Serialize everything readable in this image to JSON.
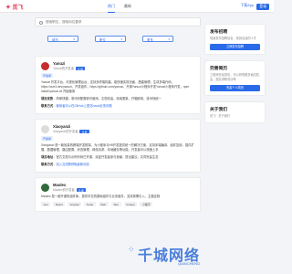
{
  "header": {
    "logo": "觅飞",
    "logo_icon": "feather-icon",
    "tabs": [
      {
        "label": "热门"
      },
      {
        "label": "最新"
      }
    ],
    "download_label": "下载App",
    "login_label": "登录"
  },
  "search": {
    "placeholder": "搜索职位、搜索岗位要求"
  },
  "filters": [
    {
      "label": "城市"
    },
    {
      "label": "职位"
    },
    {
      "label": "更多"
    }
  ],
  "posts": [
    {
      "username": "Yanuzi",
      "subtitle": "Yanuzi的开发者",
      "badge": "认证",
      "tag": "开发者",
      "body": "Yanuzi 开发平台，可视化管理后台，支持多终端构建，能快速实现页面，搭建管理，生成多端代码，https://vue3.dev/yanuzi，开发组件，https://github.com/yanuzi，开源Yanuzi小程序开发Yanuzi小程序开发，npm install yanuzi-cli 开始使用",
      "para2_label": "项目优势",
      "para2": "简单快捷，零代码配置即可使用，文档完善，持续更新，开箱即用，技术栈统一",
      "para3_label": "联系方式",
      "para3_link": "使用者可以在GitHub上提交Issue反馈问题"
    },
    {
      "username": "Xiaoyanzi",
      "subtitle": "Xiaoyanzi的开发者",
      "badge": "认证",
      "tag": "开发者",
      "body": "Xiaoyanzi 是一款轻量的跨端开发框架，为小程序与H5开发提供统一的解决方案，支持多端编译、组件复用、插件扩展、数据管理、路由配置、状态管理、网络请求、本地缓存等功能，开发者可以快速上手",
      "para2_label": "项目地址",
      "para2": "官方文档与示例代码已开源，欢迎开发者参与贡献，提出建议，共同完善生态",
      "para3_label": "联系方式",
      "para3_link": "加入交流群获取最新动态"
    },
    {
      "username": "Maolex",
      "subtitle": "Maolex的开发者",
      "badge": "认证",
      "body": "Maolex 是一款开源的组件库，提供丰富的基础组件与业务组件，支持按需引入，主题定制",
      "chips": [
        "Vue",
        "React",
        "Angular",
        "Node",
        "Web",
        "Taro",
        "Uniapp",
        "小程序"
      ]
    }
  ],
  "sidebar": {
    "publish": {
      "title": "发布招聘",
      "desc": "快速发布招聘信息，找到合适的人才",
      "button": "立即发布招聘"
    },
    "resume": {
      "title": "完善简历",
      "desc": "工程师完善简历，可以获得更多面试机会，提高求职成功率",
      "button": "完善个人简历"
    },
    "about": {
      "title": "关于我们",
      "desc": "觅飞 · 关于我们"
    }
  },
  "watermark": {
    "main": "千城网络",
    "sub": "QIANCHENG"
  },
  "colors": {
    "accent": "#2a6ae8",
    "logo": "#e83e5a",
    "background": "#f2f4f7"
  }
}
